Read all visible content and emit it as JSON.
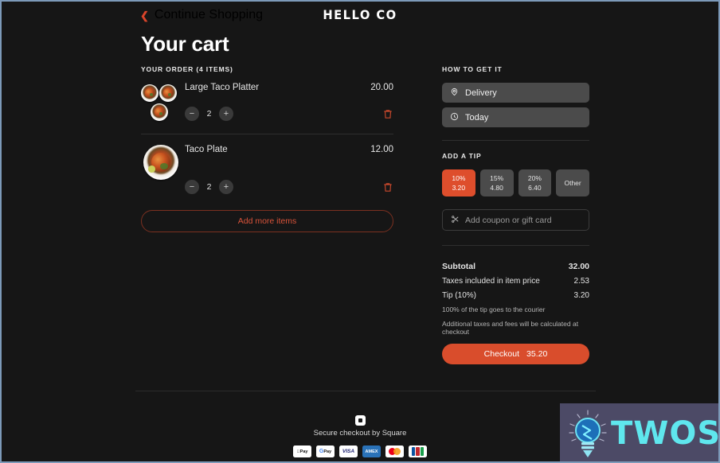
{
  "header": {
    "continue_shopping": "Continue Shopping",
    "back_icon": "chevron-left-icon",
    "brand": "HELLO CO"
  },
  "page_title": "Your cart",
  "order": {
    "section_label": "YOUR ORDER (4 ITEMS)",
    "items": [
      {
        "name": "Large Taco Platter",
        "price": "20.00",
        "qty": "2",
        "decrement": "−",
        "increment": "+",
        "remove_icon": "trash-icon",
        "thumb_count": 3
      },
      {
        "name": "Taco Plate",
        "price": "12.00",
        "qty": "2",
        "decrement": "−",
        "increment": "+",
        "remove_icon": "trash-icon",
        "thumb_count": 1
      }
    ],
    "add_more_label": "Add more items"
  },
  "fulfillment": {
    "section_label": "HOW TO GET IT",
    "method": "Delivery",
    "method_icon": "location-pin-icon",
    "time": "Today",
    "time_icon": "clock-icon"
  },
  "tip": {
    "section_label": "ADD A TIP",
    "options": [
      {
        "label": "10%",
        "amount": "3.20",
        "selected": true
      },
      {
        "label": "15%",
        "amount": "4.80",
        "selected": false
      },
      {
        "label": "20%",
        "amount": "6.40",
        "selected": false
      },
      {
        "label": "Other",
        "amount": "",
        "selected": false
      }
    ]
  },
  "coupon": {
    "icon": "scissors-icon",
    "placeholder": "Add coupon or gift card",
    "value": ""
  },
  "totals": {
    "subtotal_label": "Subtotal",
    "subtotal_value": "32.00",
    "taxes_label": "Taxes included in item price",
    "taxes_value": "2.53",
    "tip_label": "Tip (10%)",
    "tip_value": "3.20",
    "courier_note": "100% of the tip goes to the courier",
    "fees_note": "Additional taxes and fees will be calculated at checkout",
    "checkout_label": "Checkout",
    "checkout_total": "35.20"
  },
  "footer": {
    "square_icon": "square-logo-icon",
    "secure_text": "Secure checkout by Square",
    "payments": [
      {
        "name": "apple-pay",
        "label": "Pay"
      },
      {
        "name": "google-pay",
        "label": "Pay"
      },
      {
        "name": "visa",
        "label": "VISA"
      },
      {
        "name": "amex",
        "label": "AMEX"
      },
      {
        "name": "mastercard",
        "label": ""
      },
      {
        "name": "jcb",
        "label": ""
      }
    ]
  },
  "watermark": {
    "text": "TWOS",
    "logo_icon": "lightbulb-icon",
    "background": "#4c4a66",
    "text_color": "#5fe7ee"
  },
  "colors": {
    "page_bg": "#161616",
    "accent": "#d94d2c",
    "button_gray": "#4b4b4b",
    "border": "#7d9ab9"
  }
}
